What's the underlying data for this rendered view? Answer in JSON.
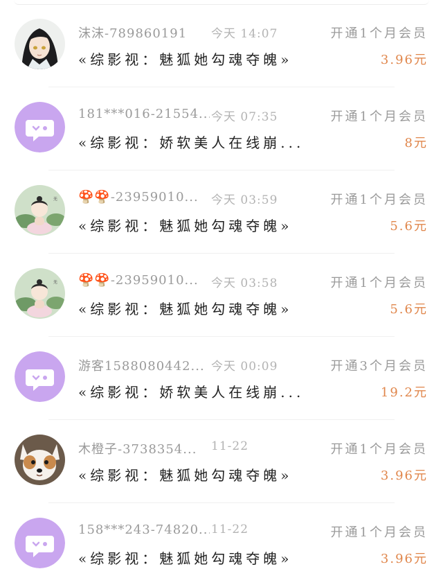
{
  "orders": [
    {
      "avatar": "anime-character",
      "name": "沫沫-789860191",
      "time": "今天 14:07",
      "plan": "开通1个月会员",
      "title": "«综影视：魅狐她勾魂夺魄»",
      "price": "3.96元"
    },
    {
      "avatar": "chat-bubble",
      "name": "181***016-21554...",
      "time": "今天 07:35",
      "plan": "开通1个月会员",
      "title": "«综影视：娇软美人在线崩...",
      "price": "8元"
    },
    {
      "avatar": "lotus-girl",
      "name_emoji": "🍄🍄",
      "name": "-23959010...",
      "time": "今天 03:59",
      "plan": "开通1个月会员",
      "title": "«综影视：魅狐她勾魂夺魄»",
      "price": "5.6元"
    },
    {
      "avatar": "lotus-girl",
      "name_emoji": "🍄🍄",
      "name": "-23959010...",
      "time": "今天 03:58",
      "plan": "开通1个月会员",
      "title": "«综影视：魅狐她勾魂夺魄»",
      "price": "5.6元"
    },
    {
      "avatar": "chat-bubble",
      "name": "游客1588080442...",
      "time": "今天 00:09",
      "plan": "开通3个月会员",
      "title": "«综影视：娇软美人在线崩...",
      "price": "19.2元"
    },
    {
      "avatar": "puppy",
      "name": "木橙子-3738354...",
      "time": "11-22",
      "plan": "开通1个月会员",
      "title": "«综影视：魅狐她勾魂夺魄»",
      "price": "3.96元"
    },
    {
      "avatar": "chat-bubble",
      "name": "158***243-74820...",
      "time": "11-22",
      "plan": "开通1个月会员",
      "title": "«综影视：魅狐她勾魂夺魄»",
      "price": "3.96元"
    }
  ],
  "colors": {
    "price": "#e0864b",
    "avatar_purple": "#c9a6ef",
    "muted": "#9a9a9a"
  }
}
